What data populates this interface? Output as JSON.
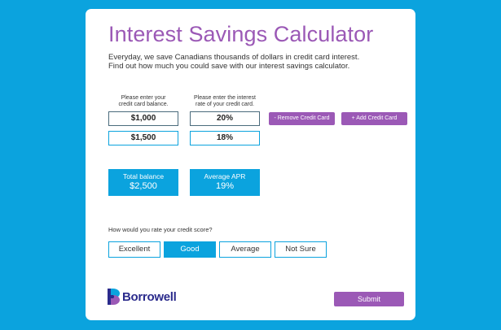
{
  "title": "Interest Savings Calculator",
  "intro": {
    "line1": "Everyday, we save Canadians thousands of dollars in credit card interest.",
    "line2": "Find out how much you could save with our interest savings calculator."
  },
  "labels": {
    "balance_line1": "Please enter your",
    "balance_line2": "credit card balance.",
    "rate_line1": "Please enter the interest",
    "rate_line2": "rate of your credit card."
  },
  "cards": [
    {
      "balance": "$1,000",
      "rate": "20%"
    },
    {
      "balance": "$1,500",
      "rate": "18%"
    }
  ],
  "buttons": {
    "remove": "- Remove Credit Card",
    "add": "+ Add Credit Card",
    "submit": "Submit"
  },
  "summary": {
    "total_label": "Total balance",
    "total_value": "$2,500",
    "apr_label": "Average APR",
    "apr_value": "19%"
  },
  "credit_question": "How would you rate your credit score?",
  "rating_options": [
    "Excellent",
    "Good",
    "Average",
    "Not Sure"
  ],
  "selected_rating": "Good",
  "brand": {
    "name": "Borrowell"
  },
  "colors": {
    "background": "#0ba3de",
    "accent_purple": "#9b59b6",
    "accent_blue": "#0ba3de",
    "logo_text": "#2b2b8c"
  }
}
